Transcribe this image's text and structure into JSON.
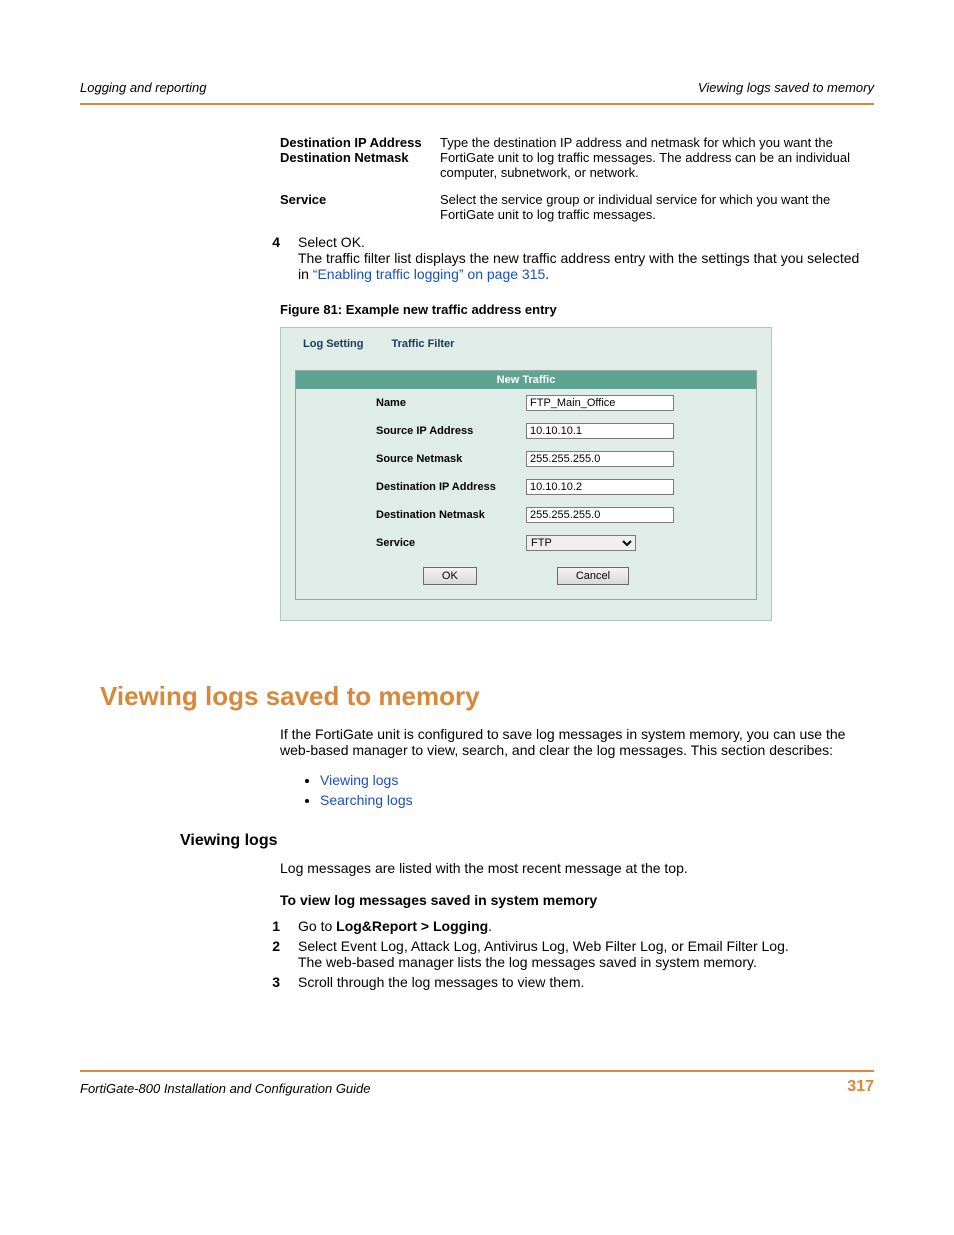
{
  "header": {
    "left": "Logging and reporting",
    "right": "Viewing logs saved to memory"
  },
  "defs": {
    "r1_term_a": "Destination IP Address",
    "r1_term_b": "Destination Netmask",
    "r1_desc": "Type the destination IP address and netmask for which you want the FortiGate unit to log traffic messages. The address can be an individual computer, subnetwork, or network.",
    "r2_term": "Service",
    "r2_desc": "Select the service group or individual service for which you want the FortiGate unit to log traffic messages."
  },
  "step4": {
    "num": "4",
    "line1": "Select OK.",
    "line2a": "The traffic filter list displays the new traffic address entry with the settings that you selected in ",
    "link": "“Enabling traffic logging” on page 315",
    "line2b": "."
  },
  "figure_caption": "Figure 81: Example new traffic address entry",
  "screenshot": {
    "tab1": "Log Setting",
    "tab2": "Traffic Filter",
    "panel_title": "New Traffic",
    "fields": {
      "name_label": "Name",
      "name_value": "FTP_Main_Office",
      "sip_label": "Source IP Address",
      "sip_value": "10.10.10.1",
      "snm_label": "Source Netmask",
      "snm_value": "255.255.255.0",
      "dip_label": "Destination IP Address",
      "dip_value": "10.10.10.2",
      "dnm_label": "Destination Netmask",
      "dnm_value": "255.255.255.0",
      "svc_label": "Service",
      "svc_value": "FTP"
    },
    "ok": "OK",
    "cancel": "Cancel"
  },
  "section_title": "Viewing logs saved to memory",
  "section_intro": "If the FortiGate unit is configured to save log messages in system memory, you can use the web-based manager to view, search, and clear the log messages. This section describes:",
  "bullets": {
    "b1": "Viewing logs",
    "b2": "Searching logs"
  },
  "sub_title": "Viewing logs",
  "sub_body": "Log messages are listed with the most recent message at the top.",
  "proc_title": "To view log messages saved in system memory",
  "proc": {
    "s1_num": "1",
    "s1_a": "Go to ",
    "s1_b": "Log&Report > Logging",
    "s1_c": ".",
    "s2_num": "2",
    "s2_a": "Select Event Log, Attack Log, Antivirus Log, Web Filter Log, or Email Filter Log.",
    "s2_b": "The web-based manager lists the log messages saved in system memory.",
    "s3_num": "3",
    "s3": "Scroll through the log messages to view them."
  },
  "footer": {
    "left": "FortiGate-800 Installation and Configuration Guide",
    "right": "317"
  }
}
